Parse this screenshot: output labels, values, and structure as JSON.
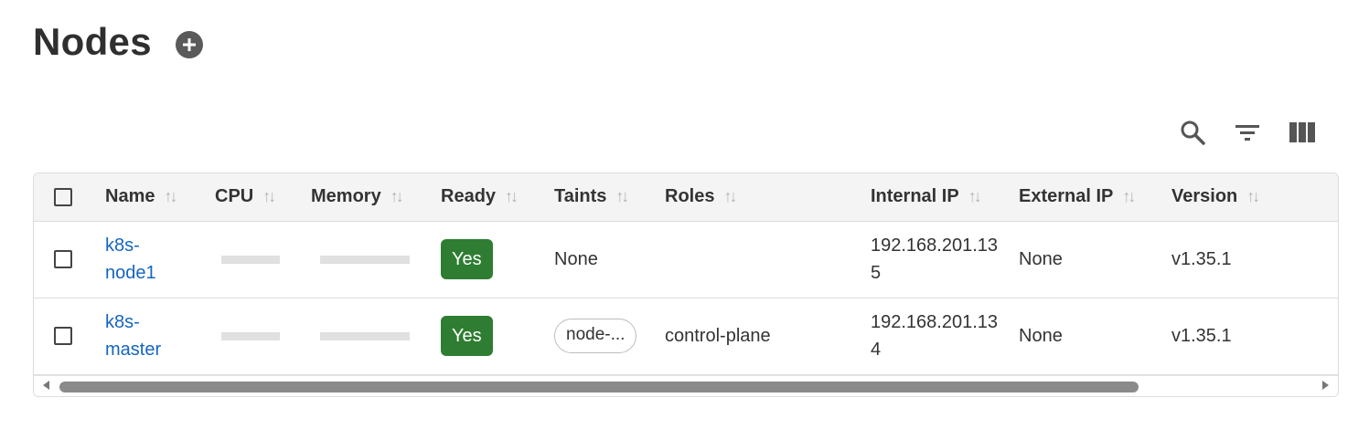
{
  "page": {
    "title": "Nodes"
  },
  "toolbar": {
    "icons": [
      "search-icon",
      "filter-icon",
      "columns-icon"
    ]
  },
  "table": {
    "columns": {
      "name": "Name",
      "cpu": "CPU",
      "memory": "Memory",
      "ready": "Ready",
      "taints": "Taints",
      "roles": "Roles",
      "internal_ip": "Internal IP",
      "external_ip": "External IP",
      "version": "Version"
    },
    "sort_glyph": "↑↓",
    "rows": [
      {
        "name_line1": "k8s-",
        "name_line2": "node1",
        "ready": "Yes",
        "taints": "None",
        "roles": "",
        "internal_ip_line1": "192.168.201.13",
        "internal_ip_line2": "5",
        "external_ip": "None",
        "version": "v1.35.1"
      },
      {
        "name_line1": "k8s-",
        "name_line2": "master",
        "ready": "Yes",
        "taints": "node-...",
        "roles": "control-plane",
        "internal_ip_line1": "192.168.201.13",
        "internal_ip_line2": "4",
        "external_ip": "None",
        "version": "v1.35.1"
      }
    ]
  },
  "colors": {
    "ready_badge": "#2e7d32",
    "link": "#1565c0",
    "header_bg": "#f4f4f4"
  }
}
